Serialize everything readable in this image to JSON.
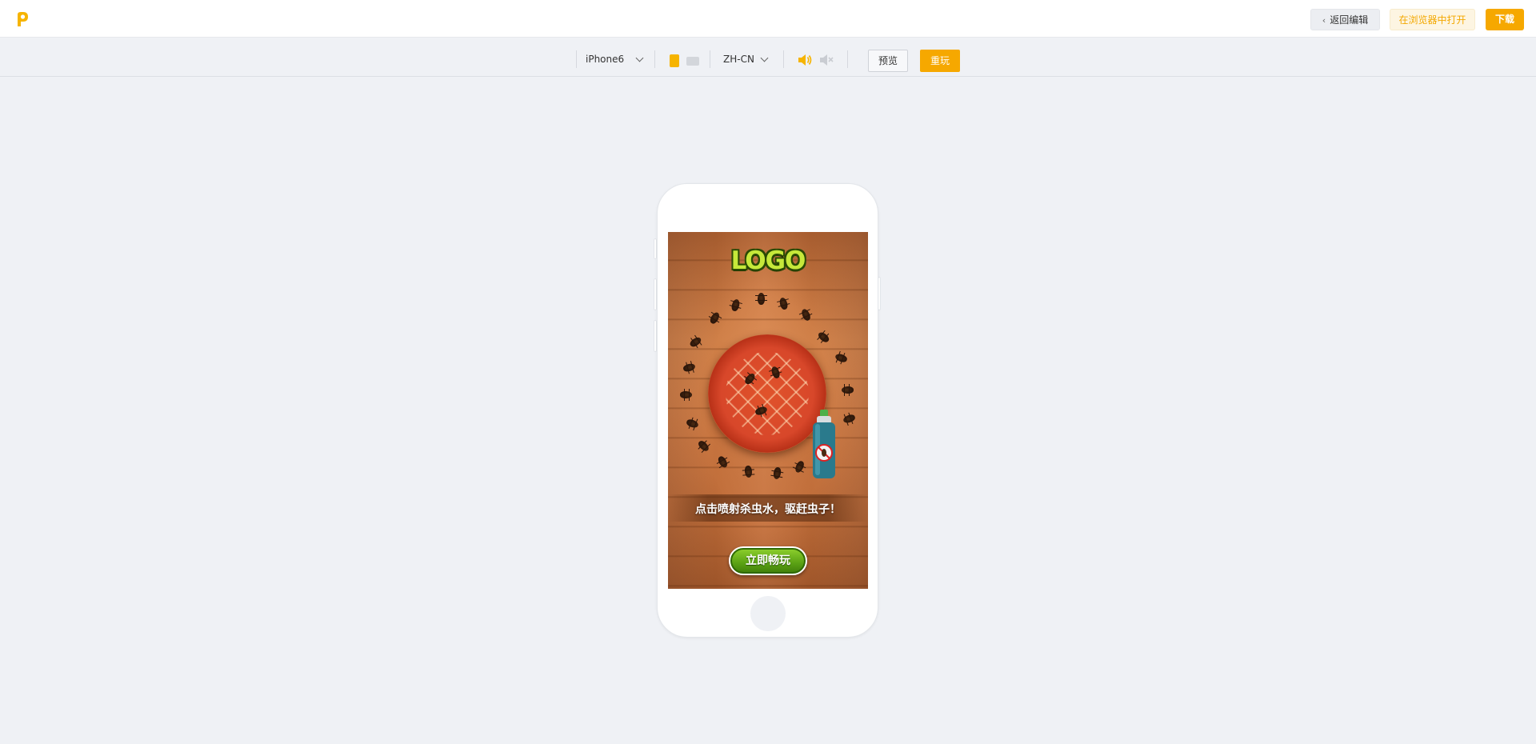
{
  "header": {
    "brand_icon": "p-logo-icon",
    "back_button": "返回编辑",
    "open_in_browser": "在浏览器中打开",
    "download": "下载",
    "accent_color": "#f6a800"
  },
  "toolbar": {
    "device": "iPhone6",
    "language": "ZH-CN",
    "preview": "预览",
    "replay": "重玩",
    "orientation_icons": [
      "portrait-icon",
      "landscape-icon"
    ],
    "sound_icons": [
      "volume-on-icon",
      "volume-mute-icon"
    ]
  },
  "game": {
    "logo_text": "LOGO",
    "prompt": "点击喷射杀虫水，驱赶虫子！",
    "play_button": "立即畅玩"
  }
}
